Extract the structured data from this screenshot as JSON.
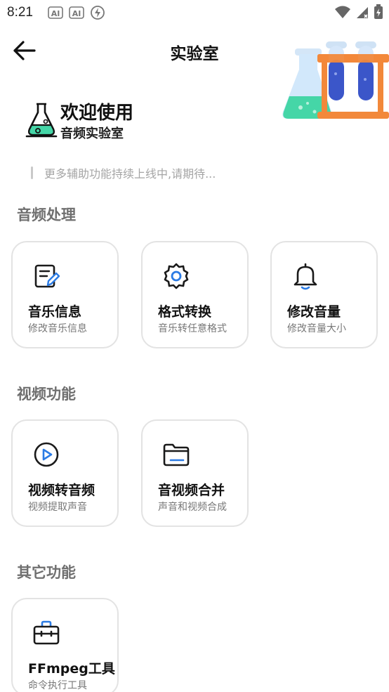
{
  "status_bar": {
    "time": "8:21",
    "left_icons": [
      "ai-icon",
      "ai-icon",
      "flash-icon"
    ],
    "right_icons": [
      "wifi-icon",
      "signal-icon",
      "battery-icon"
    ]
  },
  "header": {
    "title": "实验室",
    "back_icon": "arrow-left-icon"
  },
  "welcome": {
    "title": "欢迎使用",
    "subtitle": "音频实验室"
  },
  "notice": {
    "text": "更多辅助功能持续上线中,请期待..."
  },
  "sections": [
    {
      "title": "音频处理",
      "cards": [
        {
          "title": "音乐信息",
          "desc": "修改音乐信息",
          "icon": "edit-document-icon"
        },
        {
          "title": "格式转换",
          "desc": "音乐转任意格式",
          "icon": "settings-gear-icon"
        },
        {
          "title": "修改音量",
          "desc": "修改音量大小",
          "icon": "bell-icon"
        }
      ]
    },
    {
      "title": "视频功能",
      "cards": [
        {
          "title": "视频转音频",
          "desc": "视频提取声音",
          "icon": "play-circle-icon"
        },
        {
          "title": "音视频合并",
          "desc": "声音和视频合成",
          "icon": "folder-icon"
        }
      ]
    },
    {
      "title": "其它功能",
      "cards": [
        {
          "title": "FFmpeg工具",
          "desc": "命令执行工具",
          "icon": "toolbox-icon"
        }
      ]
    }
  ],
  "colors": {
    "accent_blue": "#2b7be4",
    "icon_dark": "#1a1a1a",
    "card_border": "#e3e3e3",
    "section_title": "#6f6f6f",
    "flask_green": "#45d6a7",
    "tube_blue": "#3b56c9",
    "rack_orange": "#f2883a"
  }
}
